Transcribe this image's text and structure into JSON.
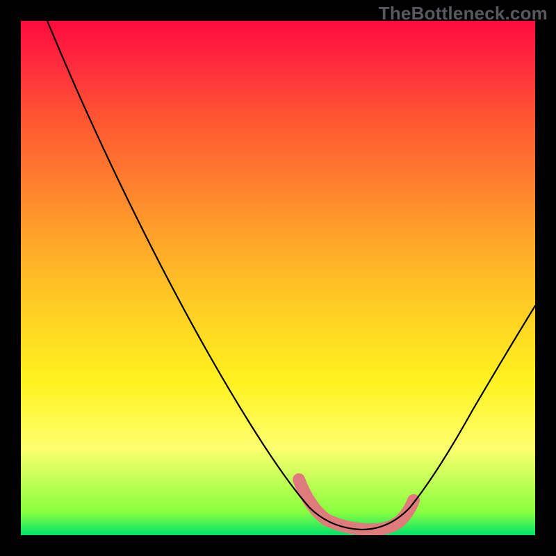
{
  "watermark": "TheBottleneck.com",
  "colors": {
    "gradient_top": "#ff0b3d",
    "gradient_upper_mid": "#ffa329",
    "gradient_mid": "#fff21f",
    "gradient_lower_mid": "#fdff6e",
    "gradient_bottom": "#00e36a",
    "curve": "#000000",
    "highlight_arc": "#e07b7b",
    "frame_background": "#000000"
  },
  "chart_data": {
    "type": "line",
    "title": "",
    "xlabel": "",
    "ylabel": "",
    "xlim": [
      0,
      100
    ],
    "ylim": [
      0,
      100
    ],
    "series": [
      {
        "name": "bottleneck-curve",
        "x": [
          5,
          10,
          20,
          30,
          40,
          50,
          55,
          58,
          62,
          68,
          72,
          75,
          80,
          88,
          96,
          100
        ],
        "y": [
          100,
          90,
          72,
          55,
          38,
          20,
          11,
          5,
          1,
          0,
          0.5,
          3,
          10,
          26,
          45,
          55
        ]
      }
    ],
    "minimum_highlight_x_range": [
      55,
      76
    ],
    "grid": false,
    "legend": false
  }
}
